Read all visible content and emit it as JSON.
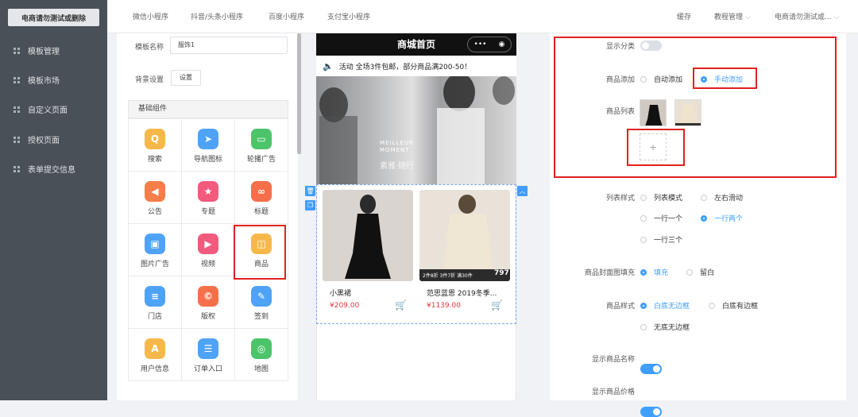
{
  "sidebar": {
    "shop_name": "电商请勿测试或删除",
    "items": [
      {
        "label": "模板管理"
      },
      {
        "label": "模板市场"
      },
      {
        "label": "自定义页面"
      },
      {
        "label": "授权页面"
      },
      {
        "label": "表单提交信息"
      }
    ]
  },
  "topbar": {
    "tabs": [
      "微信小程序",
      "抖音/头条小程序",
      "百度小程序",
      "支付宝小程序"
    ],
    "cache": "缓存",
    "tutorial": "教程管理",
    "account": "电商请勿测试或..."
  },
  "left_panel": {
    "template_name_label": "模板名称",
    "template_name_value": "服饰1",
    "bg_label": "背景设置",
    "bg_button": "设置",
    "components_header": "基础组件",
    "components": [
      {
        "label": "搜索",
        "icon": "search-icon",
        "color": "#f7b84b"
      },
      {
        "label": "导航图标",
        "icon": "navigation-icon",
        "color": "#4fa3f7"
      },
      {
        "label": "轮播广告",
        "icon": "carousel-icon",
        "color": "#4cc46a"
      },
      {
        "label": "公告",
        "icon": "announcement-icon",
        "color": "#f57d4a"
      },
      {
        "label": "专题",
        "icon": "topic-icon",
        "color": "#f25a7e"
      },
      {
        "label": "标题",
        "icon": "title-link-icon",
        "color": "#f5704a"
      },
      {
        "label": "图片广告",
        "icon": "image-ad-icon",
        "color": "#4fa3f7"
      },
      {
        "label": "视频",
        "icon": "video-icon",
        "color": "#f25a7e"
      },
      {
        "label": "商品",
        "icon": "goods-bag-icon",
        "color": "#f7b84b"
      },
      {
        "label": "门店",
        "icon": "store-icon",
        "color": "#4fa3f7"
      },
      {
        "label": "版权",
        "icon": "copyright-icon",
        "color": "#f5704a"
      },
      {
        "label": "签到",
        "icon": "checkin-icon",
        "color": "#4fa3f7"
      },
      {
        "label": "用户信息",
        "icon": "user-info-icon",
        "color": "#f7b84b"
      },
      {
        "label": "订单入口",
        "icon": "order-entry-icon",
        "color": "#4fa3f7"
      },
      {
        "label": "地图",
        "icon": "map-icon",
        "color": "#4cc46a"
      }
    ]
  },
  "preview": {
    "title": "商城首页",
    "capsule_dots": "•••",
    "notice": "活动  全场3件包邮，部分商品满200-50！",
    "banner_line1": "MEILLEUR",
    "banner_line2": "MOMENT",
    "banner_cn": "素雅·随行",
    "goods": [
      {
        "name": "小黑裙",
        "price": "¥209.00"
      },
      {
        "name": "范思蓝恩 2019冬季...",
        "price": "¥1139.00"
      }
    ],
    "promo": "2件8折 3件7折 满30件",
    "promo_price": "797"
  },
  "right_panel": {
    "show_category_label": "显示分类",
    "goods_add_label": "商品添加",
    "auto_add": "自动添加",
    "manual_add": "手动添加",
    "goods_list_label": "商品列表",
    "add_plus": "+",
    "list_style_label": "列表样式",
    "list_styles": [
      "列表模式",
      "左右滑动",
      "一行一个",
      "一行两个",
      "一行三个"
    ],
    "cover_fill_label": "商品封面图填充",
    "cover_fill": [
      "填充",
      "留白"
    ],
    "goods_style_label": "商品样式",
    "goods_styles": [
      "白底无边框",
      "白底有边框",
      "无底无边框"
    ],
    "show_name_label": "显示商品名称",
    "show_price_label": "显示商品价格"
  },
  "colors": {
    "accent": "#409eff",
    "price": "#e4393c",
    "highlight_border": "#e02020"
  }
}
